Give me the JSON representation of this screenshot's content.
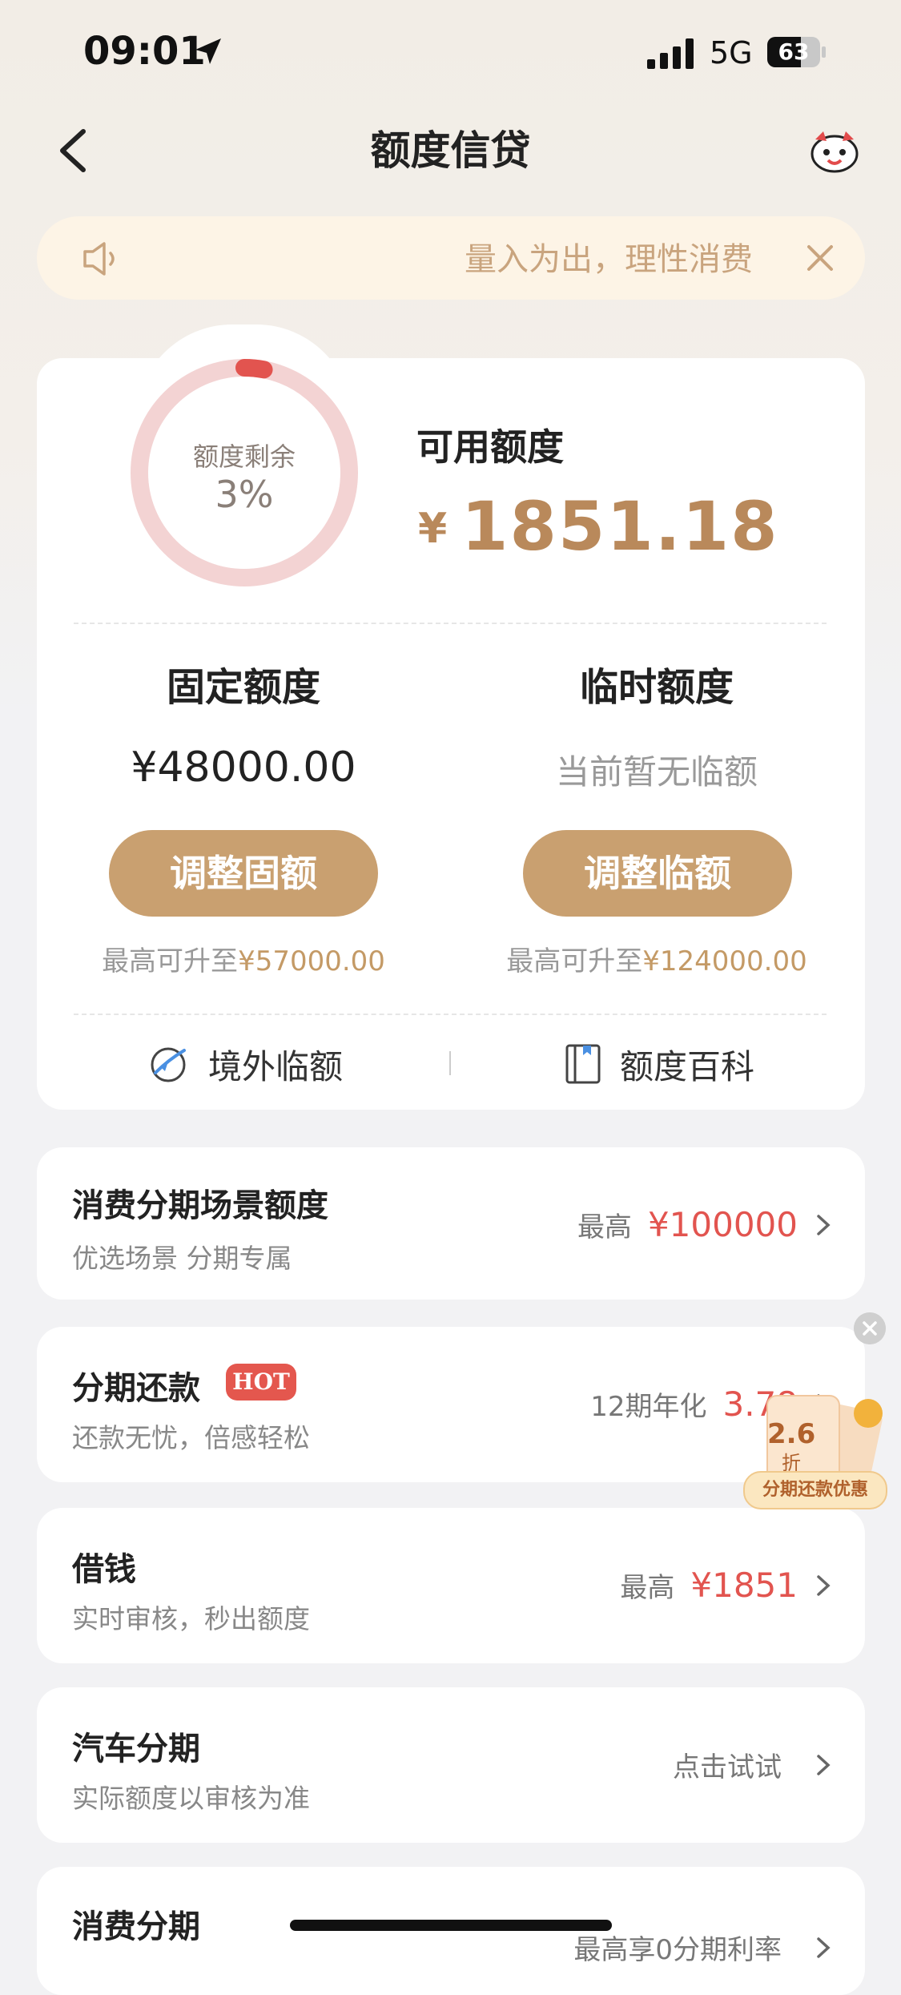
{
  "status_bar": {
    "time": "09:01",
    "network": "5G",
    "battery": "63",
    "battery_level_percent": 63
  },
  "header": {
    "title": "额度信贷"
  },
  "notice": {
    "text": "量入为出，理性消费"
  },
  "quota": {
    "ring_label": "额度剩余",
    "ring_value": "3%",
    "remaining_percent": 3,
    "available_label": "可用额度",
    "currency": "¥",
    "available_amount": "1851.18",
    "fixed": {
      "title": "固定额度",
      "amount": "¥48000.00",
      "button": "调整固额",
      "upto_prefix": "最高可升至",
      "upto_value": "¥57000.00"
    },
    "temp": {
      "title": "临时额度",
      "status": "当前暂无临额",
      "button": "调整临额",
      "upto_prefix": "最高可升至",
      "upto_value": "¥124000.00"
    },
    "links": {
      "overseas": "境外临额",
      "wiki": "额度百科"
    }
  },
  "items": [
    {
      "title": "消费分期场景额度",
      "sub": "优选场景 分期专属",
      "pre": "最高",
      "value": "¥100000"
    },
    {
      "title": "分期还款",
      "badge": "HOT",
      "sub": "还款无忧，倍感轻松",
      "pre": "12期年化",
      "value": "3.78"
    },
    {
      "title": "借钱",
      "sub": "实时审核，秒出额度",
      "pre": "最高",
      "value": "¥1851"
    },
    {
      "title": "汽车分期",
      "sub": "实际额度以审核为准",
      "pre": "点击试试",
      "value": ""
    },
    {
      "title": "消费分期",
      "sub": "",
      "pre": "最高享0分期利率",
      "value": ""
    }
  ],
  "promo": {
    "number": "2.6",
    "unit": "折",
    "label": "分期还款优惠"
  },
  "colors": {
    "gold": "#c9a070",
    "accent_red": "#e2544f",
    "ring": "#f3d3d3"
  }
}
